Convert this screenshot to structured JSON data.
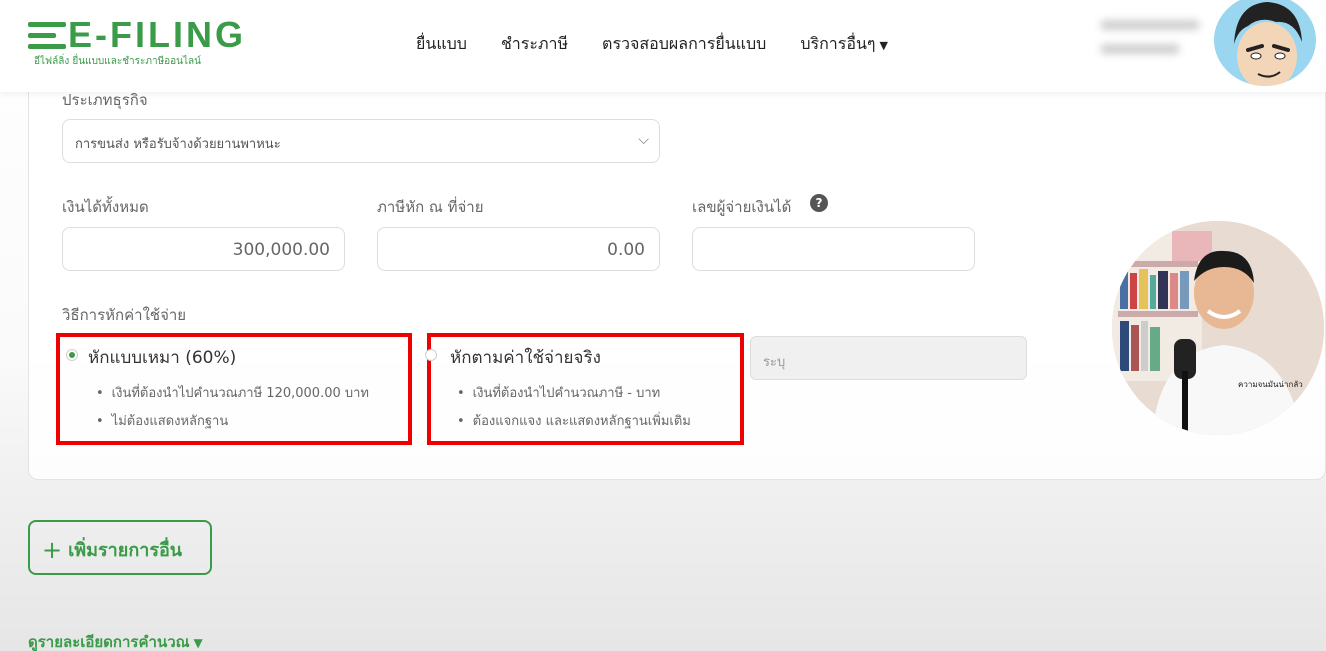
{
  "header": {
    "logo_text": "E-FILING",
    "logo_sub": "อีไฟล์ลิ่ง ยื่นแบบและชำระภาษีออนไลน์",
    "nav": [
      "ยื่นแบบ",
      "ชำระภาษี",
      "ตรวจสอบผลการยื่นแบบ",
      "บริการอื่นๆ"
    ],
    "brand_color": "#3a9b48"
  },
  "form": {
    "business_type_label": "ประเภทธุรกิจ",
    "business_type_value": "การขนส่ง หรือรับจ้างด้วยยานพาหนะ",
    "total_income_label": "เงินได้ทั้งหมด",
    "total_income_value": "300,000.00",
    "withholding_tax_label": "ภาษีหัก ณ ที่จ่าย",
    "withholding_tax_value": "0.00",
    "payer_id_label": "เลขผู้จ่ายเงินได้",
    "payer_id_value": "",
    "deduction_method_label": "วิธีการหักค่าใช้จ่าย",
    "options": [
      {
        "title": "หักแบบเหมา (60%)",
        "selected": true,
        "bullets": [
          "เงินที่ต้องนำไปคำนวณภาษี 120,000.00 บาท",
          "ไม่ต้องแสดงหลักฐาน"
        ]
      },
      {
        "title": "หักตามค่าใช้จ่ายจริง",
        "selected": false,
        "bullets": [
          "เงินที่ต้องนำไปคำนวณภาษี - บาท",
          "ต้องแจกแจง และแสดงหลักฐานเพิ่มเติม"
        ]
      }
    ],
    "specify_placeholder": "ระบุ",
    "highlight_color": "#ee0000"
  },
  "actions": {
    "add_item_label": "เพิ่มรายการอื่น",
    "view_details_label": "ดูรายละเอียดการคำนวณ"
  },
  "overlay": {
    "shirt_text": "ความจนมันน่ากลัว"
  }
}
